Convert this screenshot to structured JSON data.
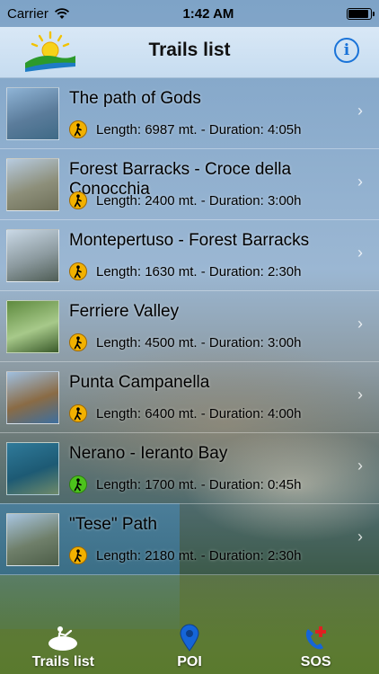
{
  "status": {
    "carrier": "Carrier",
    "time": "1:42 AM",
    "battery_level": 0.95
  },
  "nav": {
    "title": "Trails list",
    "info_symbol": "i"
  },
  "trails": [
    {
      "name": "The path of Gods",
      "info": "Length: 6987 mt. - Duration: 4:05h",
      "difficulty_color": "#f2b100",
      "thumb": [
        "#8fb4d6",
        "#5b7c9b",
        "#3f6a86"
      ]
    },
    {
      "name": "Forest Barracks - Croce della Conocchia",
      "info": "Length: 2400 mt. - Duration: 3:00h",
      "difficulty_color": "#f2b100",
      "thumb": [
        "#b7cbe0",
        "#8d8f7a",
        "#6e6f58"
      ]
    },
    {
      "name": "Montepertuso - Forest Barracks",
      "info": "Length: 1630 mt. - Duration: 2:30h",
      "difficulty_color": "#f2b100",
      "thumb": [
        "#c9d8e6",
        "#8c9a9f",
        "#4f5d55"
      ]
    },
    {
      "name": "Ferriere Valley",
      "info": "Length: 4500 mt. - Duration: 3:00h",
      "difficulty_color": "#f2b100",
      "thumb": [
        "#5e8a3e",
        "#a7c98a",
        "#3a5a2a"
      ]
    },
    {
      "name": "Punta Campanella",
      "info": "Length: 6400 mt. - Duration: 4:00h",
      "difficulty_color": "#f2b100",
      "thumb": [
        "#9fbfe0",
        "#8a6b45",
        "#3d6fa0"
      ]
    },
    {
      "name": "Nerano - Ieranto Bay",
      "info": "Length: 1700 mt. - Duration: 0:45h",
      "difficulty_color": "#4cc21c",
      "thumb": [
        "#2f7a9a",
        "#1d5a74",
        "#6f8a6a"
      ]
    },
    {
      "name": "\"Tese\" Path",
      "info": "Length: 2180 mt. - Duration: 2:30h",
      "difficulty_color": "#f2b100",
      "thumb": [
        "#a8c5e0",
        "#6f7f6a",
        "#4d5e48"
      ]
    }
  ],
  "tabs": [
    {
      "label": "Trails list",
      "icon": "hiker-icon"
    },
    {
      "label": "POI",
      "icon": "map-pin-icon"
    },
    {
      "label": "SOS",
      "icon": "emergency-phone-icon"
    }
  ]
}
